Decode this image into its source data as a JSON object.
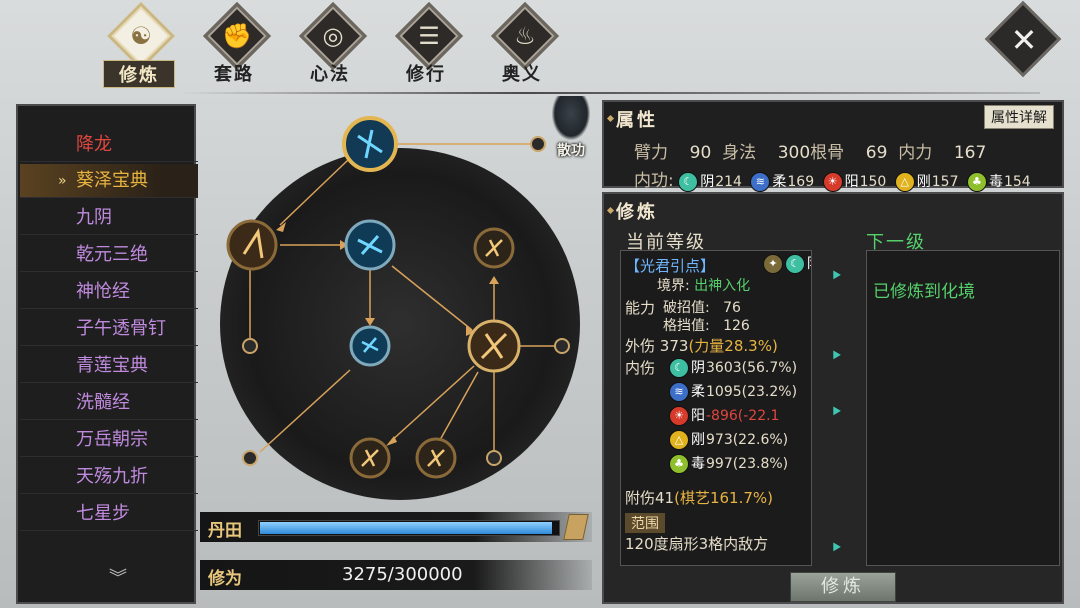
{
  "tabs": [
    {
      "label": "修炼",
      "icon": "yin-yang-icon",
      "glyph": "☯",
      "active": true
    },
    {
      "label": "套路",
      "icon": "fist-icon",
      "glyph": "✊",
      "active": false
    },
    {
      "label": "心法",
      "icon": "swirl-icon",
      "glyph": "◎",
      "active": false
    },
    {
      "label": "修行",
      "icon": "scroll-icon",
      "glyph": "☰",
      "active": false
    },
    {
      "label": "奥义",
      "icon": "flame-icon",
      "glyph": "♨",
      "active": false
    }
  ],
  "close": {
    "glyph": "✕",
    "icon": "close-icon"
  },
  "skill_list": {
    "items": [
      {
        "label": "降龙",
        "color": "red"
      },
      {
        "label": "葵泽宝典",
        "color": "gold",
        "selected": true
      },
      {
        "label": "九阴",
        "color": "purple"
      },
      {
        "label": "乾元三绝",
        "color": "purple"
      },
      {
        "label": "神怆经",
        "color": "purple"
      },
      {
        "label": "子午透骨钉",
        "color": "purple"
      },
      {
        "label": "青莲宝典",
        "color": "purple"
      },
      {
        "label": "洗髓经",
        "color": "purple"
      },
      {
        "label": "万岳朝宗",
        "color": "purple"
      },
      {
        "label": "天殇九折",
        "color": "purple"
      },
      {
        "label": "七星步",
        "color": "purple"
      }
    ],
    "scroll_glyph": "︾",
    "selected_marker": "»"
  },
  "scatter_skill": {
    "label": "散功"
  },
  "dantian": {
    "label": "丹田",
    "fill_fraction": 0.98
  },
  "xiuwei": {
    "label": "修为",
    "value": "3275/300000"
  },
  "attributes": {
    "title": "属性",
    "detail_button": "属性详解",
    "stats_row1": [
      {
        "key": "臂力",
        "value": "90"
      },
      {
        "key": "身法",
        "value": "300"
      },
      {
        "key": "根骨",
        "value": "69"
      },
      {
        "key": "内力",
        "value": "167"
      }
    ],
    "neigong_label": "内功:",
    "neigong": [
      {
        "name": "阴",
        "value": "214",
        "color": "#3fbfa2",
        "symbol": "☾"
      },
      {
        "name": "柔",
        "value": "169",
        "color": "#3d6fc8",
        "symbol": "≋"
      },
      {
        "name": "阳",
        "value": "150",
        "color": "#d63a2a",
        "symbol": "☀"
      },
      {
        "name": "刚",
        "value": "157",
        "color": "#e0b21e",
        "symbol": "△"
      },
      {
        "name": "毒",
        "value": "154",
        "color": "#8fbf2c",
        "symbol": "♣"
      }
    ]
  },
  "cultivation": {
    "title": "修炼",
    "current_title": "当前等级",
    "next_title": "下一级",
    "node_name": "【光君引点】",
    "node_tag": "阴",
    "realm_key": "境界:",
    "realm_value": "出神入化",
    "ability_key": "能力",
    "ability": [
      {
        "key": "破招值:",
        "value": "76"
      },
      {
        "key": "格挡值:",
        "value": "126"
      }
    ],
    "outer_dmg_key": "外伤",
    "outer_dmg_value": "373",
    "outer_dmg_extra": "(力量28.3%)",
    "inner_dmg_key": "内伤",
    "inner_dmg": [
      {
        "name": "阴",
        "value": "3603(56.7%)",
        "color": "#3fbfa2",
        "symbol": "☾",
        "text_color": "normal"
      },
      {
        "name": "柔",
        "value": "1095(23.2%)",
        "color": "#3d6fc8",
        "symbol": "≋",
        "text_color": "normal"
      },
      {
        "name": "阳",
        "value": "-896(-22.1",
        "color": "#d63a2a",
        "symbol": "☀",
        "text_color": "red"
      },
      {
        "name": "刚",
        "value": "973(22.6%)",
        "color": "#e0b21e",
        "symbol": "△",
        "text_color": "normal"
      },
      {
        "name": "毒",
        "value": "997(23.8%)",
        "color": "#8fbf2c",
        "symbol": "♣",
        "text_color": "normal"
      }
    ],
    "attach_key": "附伤",
    "attach_value": "41",
    "attach_extra": "(棋艺161.7%)",
    "range_tag": "范围",
    "range_text": "120度扇形3格内敌方",
    "next_text": "已修炼到化境",
    "arrow_glyph": "⯈",
    "button": "修炼"
  }
}
